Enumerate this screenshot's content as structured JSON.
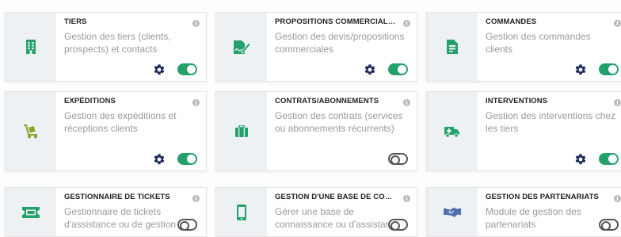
{
  "modules": [
    {
      "title": "TIERS",
      "description": "Gestion des tiers (clients, prospects) et contacts",
      "icon": "building-icon",
      "enabled": true,
      "has_settings": true
    },
    {
      "title": "PROPOSITIONS COMMERCIALES",
      "description": "Gestion des devis/propositions commerciales",
      "icon": "signed-document-icon",
      "enabled": true,
      "has_settings": true
    },
    {
      "title": "COMMANDES",
      "description": "Gestion des commandes clients",
      "icon": "order-file-icon",
      "enabled": true,
      "has_settings": true
    },
    {
      "title": "EXPÉDITIONS",
      "description": "Gestion des expéditions et réceptions clients",
      "icon": "dolly-icon",
      "enabled": true,
      "has_settings": true
    },
    {
      "title": "CONTRATS/ABONNEMENTS",
      "description": "Gestion des contrats (services ou abonnements récurrents)",
      "icon": "briefcase-icon",
      "enabled": false,
      "has_settings": false
    },
    {
      "title": "INTERVENTIONS",
      "description": "Gestion des interventions chez les tiers",
      "icon": "ambulance-icon",
      "enabled": true,
      "has_settings": true
    },
    {
      "title": "GESTIONNAIRE DE TICKETS",
      "description": "Gestionnaire de tickets d'assistance ou de gestion de demandes",
      "icon": "ticket-icon",
      "enabled": false,
      "has_settings": false
    },
    {
      "title": "GESTION D'UNE BASE DE CONNAISSANCE",
      "description": "Gérer une base de connaissance ou d'assistance clients",
      "icon": "mobile-icon",
      "enabled": false,
      "has_settings": false
    },
    {
      "title": "GESTION DES PARTENARIATS",
      "description": "Module de gestion des partenariats",
      "icon": "handshake-icon",
      "enabled": false,
      "has_settings": false
    }
  ],
  "info_glyph": "i",
  "colors": {
    "accent_green": "#24a06b",
    "settings_navy": "#1d2a5b",
    "icon_side_bg": "#eef1f3"
  }
}
